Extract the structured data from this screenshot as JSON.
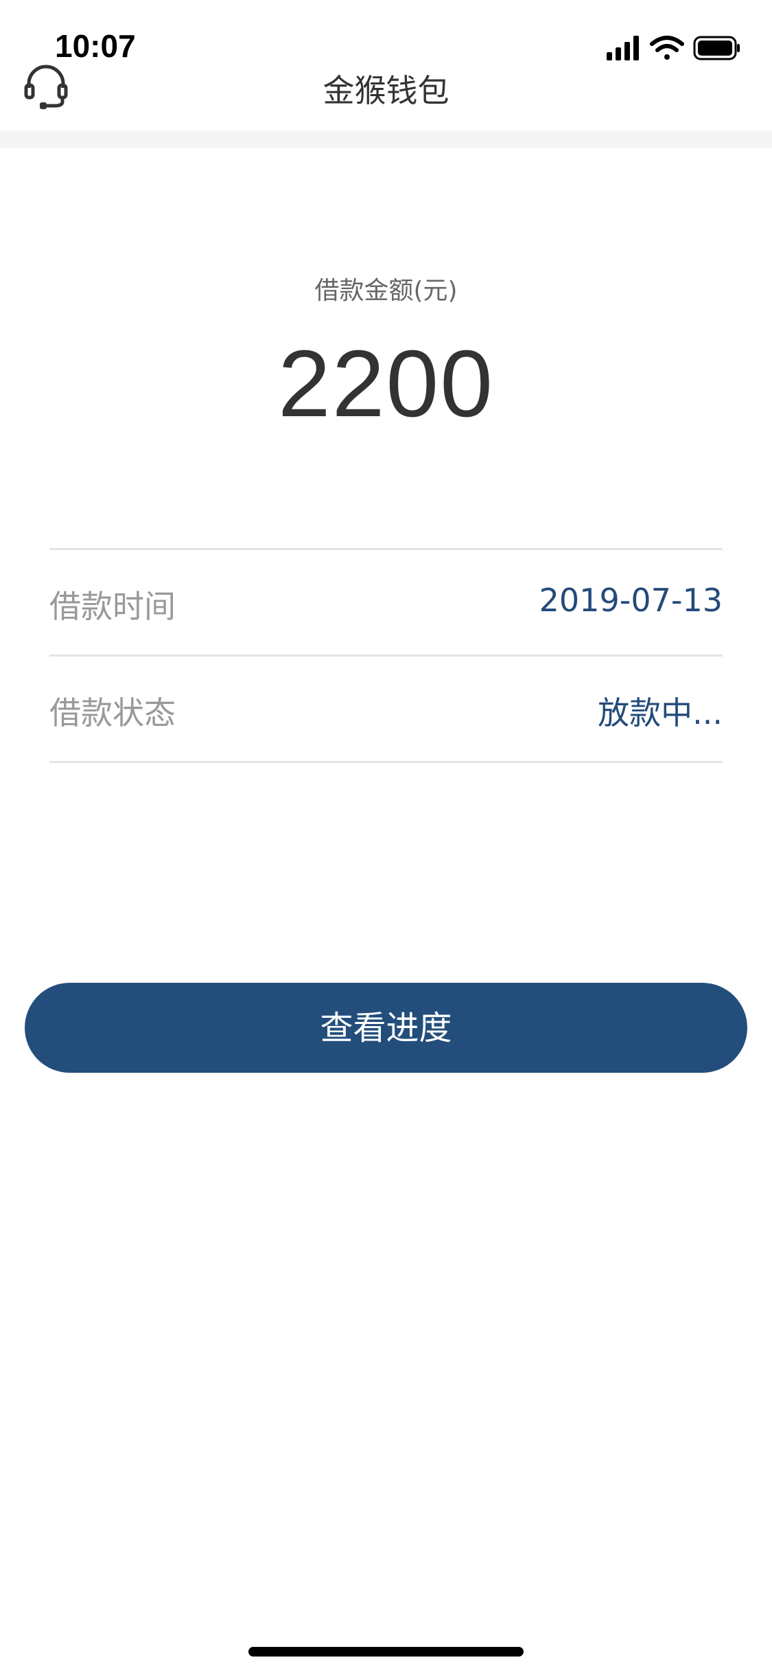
{
  "status_bar": {
    "time": "10:07"
  },
  "nav": {
    "title": "金猴钱包",
    "left_icon": "headset-icon"
  },
  "loan": {
    "amount_label": "借款金额(元)",
    "amount": "2200"
  },
  "info_rows": [
    {
      "label": "借款时间",
      "value": "2019-07-13"
    },
    {
      "label": "借款状态",
      "value": "放款中..."
    }
  ],
  "actions": {
    "view_progress": "查看进度"
  },
  "colors": {
    "primary": "#234e7c",
    "value_text": "#234b7a",
    "label_text": "#999999"
  }
}
